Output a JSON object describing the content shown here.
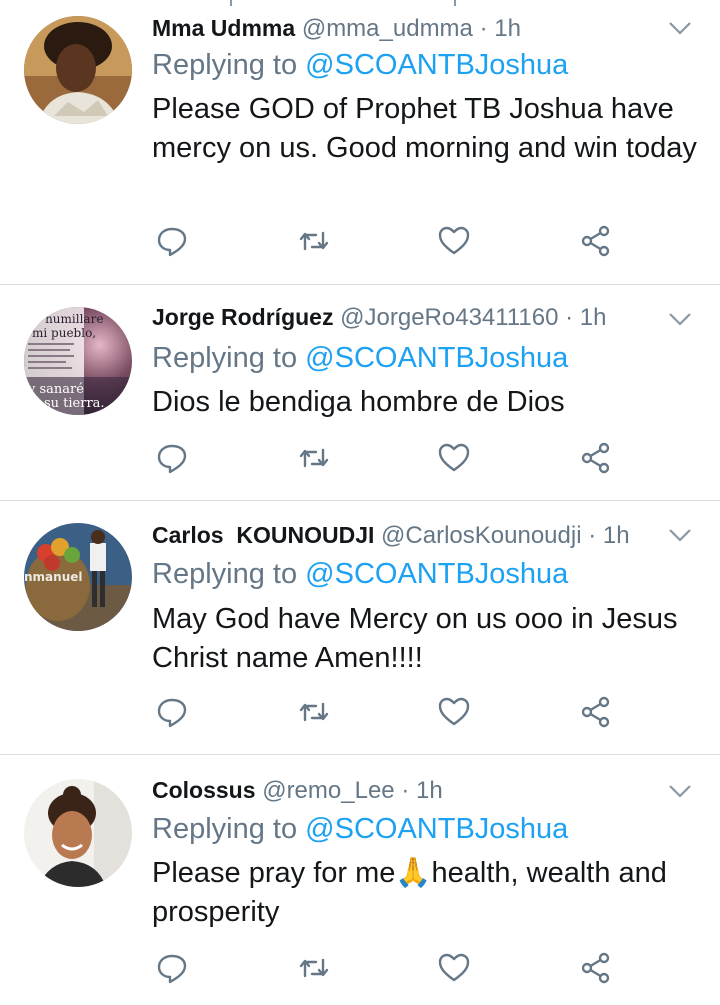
{
  "tweets": [
    {
      "name": "Mma Udmma",
      "handle": "@mma_udmma",
      "time": "1h",
      "replying_prefix": "Replying to ",
      "replying_to": "@SCOANTBJoshua",
      "text": "Please GOD of Prophet TB Joshua have mercy on us. Good morning and win today",
      "avatar_icon": "woman-portrait-avatar"
    },
    {
      "name": "Jorge Rodríguez",
      "handle": "@JorgeRo43411160",
      "time": "1h",
      "replying_prefix": "Replying to ",
      "replying_to": "@SCOANTBJoshua",
      "text": "Dios le bendiga hombre de Dios",
      "avatar_icon": "scripture-image-avatar",
      "avatar_text": [
        "se humillare",
        "mi pueblo,",
        "y sanaré",
        "su tierra."
      ]
    },
    {
      "name": "Carlos  KOUNOUDJI",
      "handle": "@CarlosKounoudji",
      "time": "1h",
      "replying_prefix": "Replying to ",
      "replying_to": "@SCOANTBJoshua",
      "text": "May God have Mercy on us ooo in Jesus Christ name Amen!!!!",
      "avatar_icon": "fruit-basket-preacher-avatar",
      "avatar_text": [
        "nmanuel"
      ]
    },
    {
      "name": "Colossus",
      "handle": "@remo_Lee",
      "time": "1h",
      "replying_prefix": "Replying to ",
      "replying_to": "@SCOANTBJoshua",
      "text_before": "Please pray for me",
      "emoji": "🙏",
      "text_after": "health, wealth and prosperity",
      "avatar_icon": "woman-smiling-avatar"
    }
  ],
  "separator": "·",
  "actions": [
    "reply-icon",
    "retweet-icon",
    "like-icon",
    "share-icon"
  ],
  "colors": {
    "link": "#1da1f2",
    "muted": "#657786",
    "text": "#14171a",
    "divider": "#d9dee2"
  }
}
